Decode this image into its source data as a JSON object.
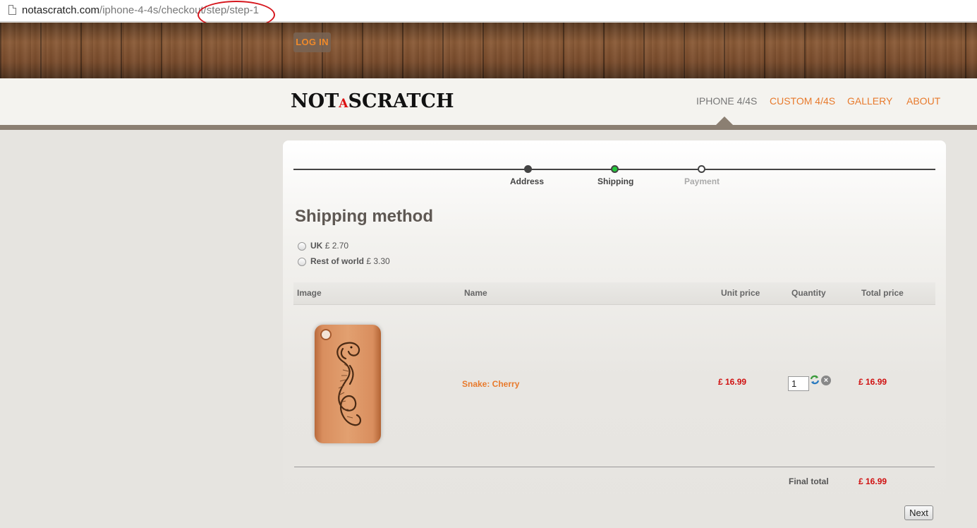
{
  "browser": {
    "url_host": "notascratch.com",
    "url_path": "/iphone-4-4s/checkout/step/step-1"
  },
  "header": {
    "login_label": "LOG IN",
    "logo_left": "NOT",
    "logo_a": "A",
    "logo_right": "SCRATCH"
  },
  "nav": {
    "items": [
      {
        "label": "IPHONE 4/4S",
        "active": true
      },
      {
        "label": "CUSTOM 4/4S",
        "active": false
      },
      {
        "label": "GALLERY",
        "active": false
      },
      {
        "label": "ABOUT",
        "active": false
      }
    ]
  },
  "steps": [
    {
      "label": "Address",
      "state": "done"
    },
    {
      "label": "Shipping",
      "state": "current"
    },
    {
      "label": "Payment",
      "state": "todo"
    }
  ],
  "shipping": {
    "heading": "Shipping method",
    "options": [
      {
        "name": "UK",
        "price": "£ 2.70"
      },
      {
        "name": "Rest of world",
        "price": "£ 3.30"
      }
    ]
  },
  "table": {
    "headers": {
      "image": "Image",
      "name": "Name",
      "unit_price": "Unit price",
      "quantity": "Quantity",
      "total_price": "Total price"
    },
    "rows": [
      {
        "name": "Snake: Cherry",
        "unit_price": "£ 16.99",
        "quantity": "1",
        "total_price": "£ 16.99"
      }
    ]
  },
  "summary": {
    "final_label": "Final total",
    "final_value": "£ 16.99"
  },
  "actions": {
    "next_label": "Next"
  },
  "colors": {
    "accent_orange": "#e87a2c",
    "price_red": "#d01010",
    "current_step_green": "#22c93a",
    "annotation_red": "#d6161d"
  }
}
